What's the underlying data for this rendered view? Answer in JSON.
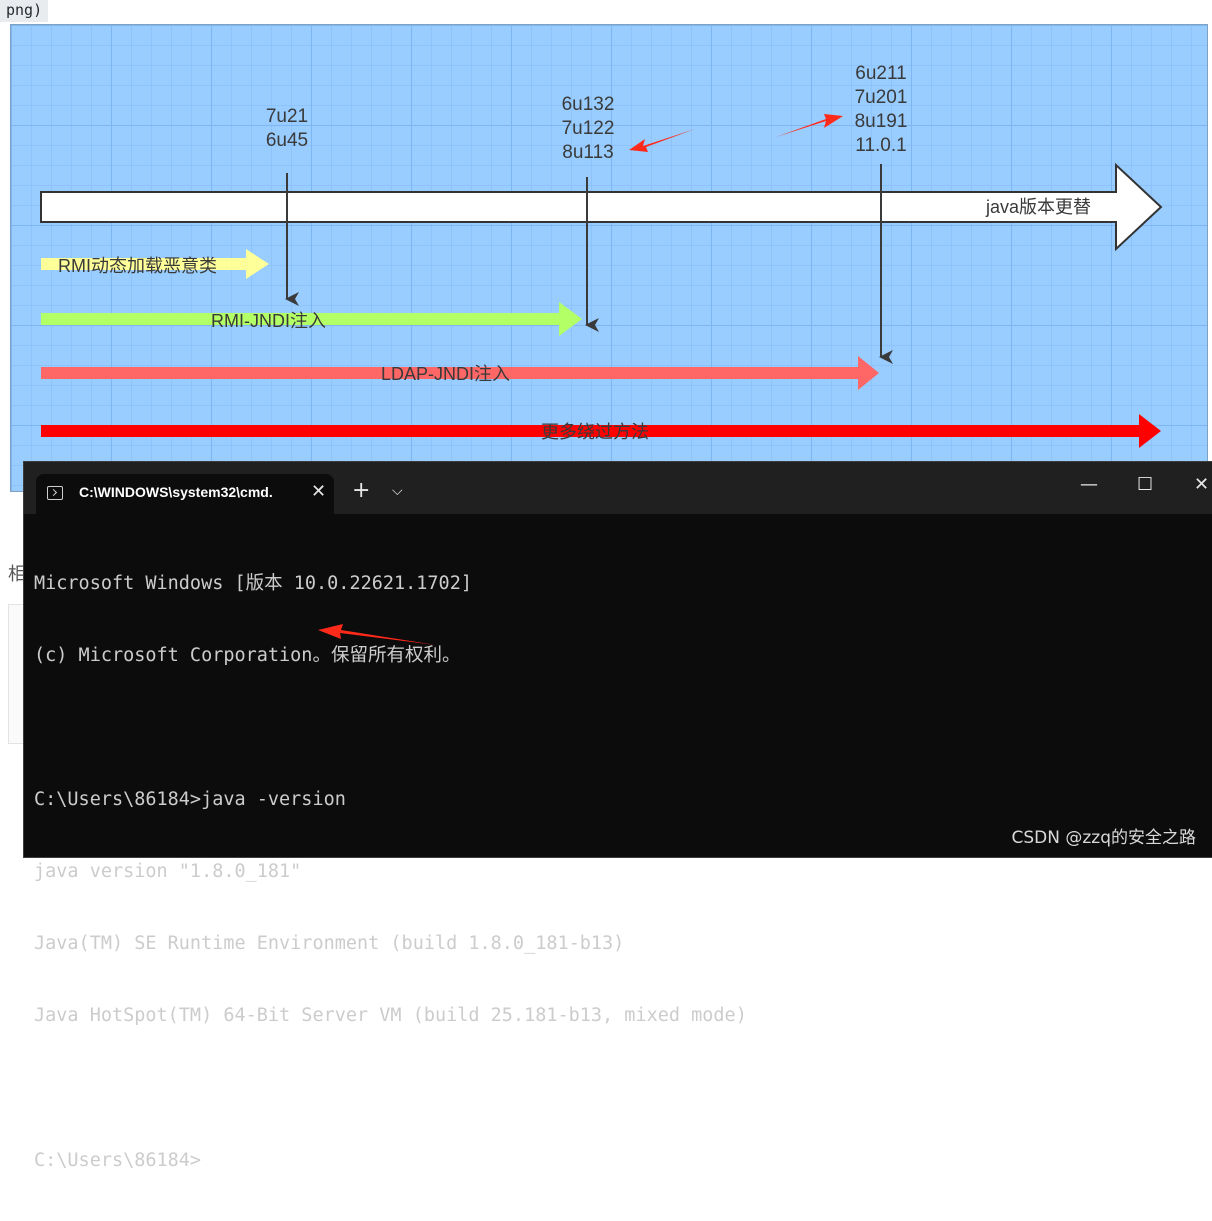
{
  "page_top_snippet": "png)",
  "page_side_snippet": "相",
  "diagram": {
    "version_groups": [
      {
        "lines": [
          "7u21",
          "6u45"
        ]
      },
      {
        "lines": [
          "6u132",
          "7u122",
          "8u113"
        ]
      },
      {
        "lines": [
          "6u211",
          "7u201",
          "8u191",
          "11.0.1"
        ]
      }
    ],
    "timeline_label": "java版本更替",
    "arrows": [
      {
        "label": "RMI动态加载恶意类",
        "color": "#ffff99"
      },
      {
        "label": "RMI-JNDI注入",
        "color": "#b3ff66"
      },
      {
        "label": "LDAP-JNDI注入",
        "color": "#ff6666"
      },
      {
        "label": "更多绕过方法",
        "color": "#ff0000"
      }
    ]
  },
  "terminal": {
    "tab_title": "C:\\WINDOWS\\system32\\cmd.",
    "close_tab_glyph": "✕",
    "new_tab_glyph": "+",
    "dropdown_glyph": "⌵",
    "minimize_glyph": "—",
    "maximize_glyph": "☐",
    "close_window_glyph": "✕",
    "lines": [
      "Microsoft Windows [版本 10.0.22621.1702]",
      "(c) Microsoft Corporation。保留所有权利。",
      "",
      "C:\\Users\\86184>java -version",
      "java version \"1.8.0_181\"",
      "Java(TM) SE Runtime Environment (build 1.8.0_181-b13)",
      "Java HotSpot(TM) 64-Bit Server VM (build 25.181-b13, mixed mode)",
      "",
      "C:\\Users\\86184>"
    ]
  },
  "watermark": "CSDN @zzq的安全之路",
  "colors": {
    "annotation_red": "#ff2a1a",
    "terminal_bg": "#0c0c0c",
    "diagram_bg": "#99ccff"
  }
}
